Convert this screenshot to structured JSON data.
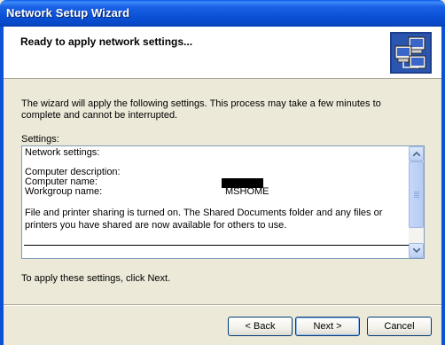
{
  "window": {
    "title": "Network Setup Wizard"
  },
  "header": {
    "heading": "Ready to apply network settings..."
  },
  "main": {
    "description": "The wizard will apply the following settings. This process may take a few minutes to complete and cannot be interrupted.",
    "settings_label": "Settings:",
    "settings_box": {
      "network_settings_label": "Network settings:",
      "computer_description_label": "Computer description:",
      "computer_name_label": "Computer name:",
      "workgroup_name_label": "Workgroup name:",
      "workgroup_name_value": "MSHOME",
      "sharing_text": "File and printer sharing is turned on. The Shared Documents folder and any files or printers you have shared are now available for others to use."
    },
    "apply_hint": "To apply these settings, click Next."
  },
  "buttons": {
    "back": "< Back",
    "next": "Next >",
    "cancel": "Cancel"
  }
}
